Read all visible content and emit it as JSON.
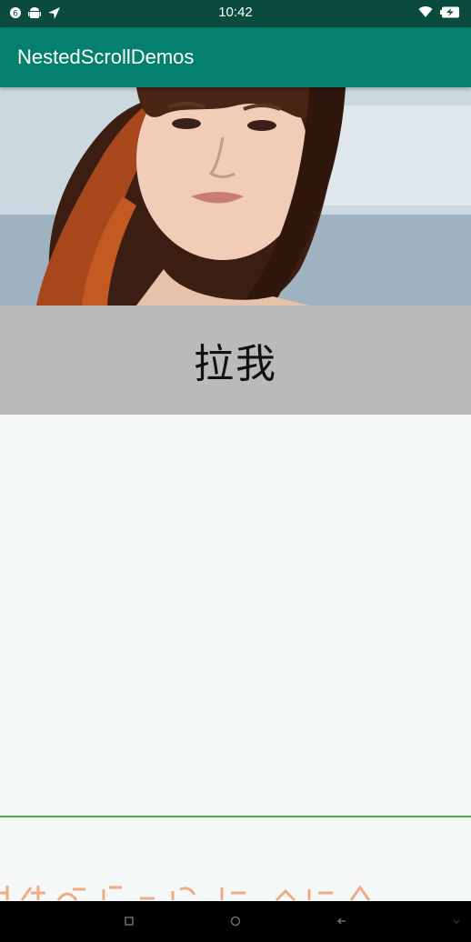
{
  "status_bar": {
    "time": "10:42",
    "icons_left": [
      "notification-icon",
      "android-icon",
      "location-arrow-icon"
    ],
    "icons_right": [
      "wifi-icon",
      "battery-charging-icon"
    ]
  },
  "app_bar": {
    "title": "NestedScrollDemos"
  },
  "header_image": {
    "description_icon": "portrait-photo"
  },
  "pull_bar": {
    "label": "拉我"
  },
  "nav_bar": {
    "buttons": [
      "recents-icon",
      "home-icon",
      "back-icon",
      "collapse-icon"
    ]
  },
  "colors": {
    "status_bar": "#0a4a3f",
    "app_bar": "#05806e",
    "pull_bar": "#babbb8",
    "content_bg": "#f4f8f6",
    "divider": "#4caf50",
    "peek_text": "#f0a37a"
  }
}
